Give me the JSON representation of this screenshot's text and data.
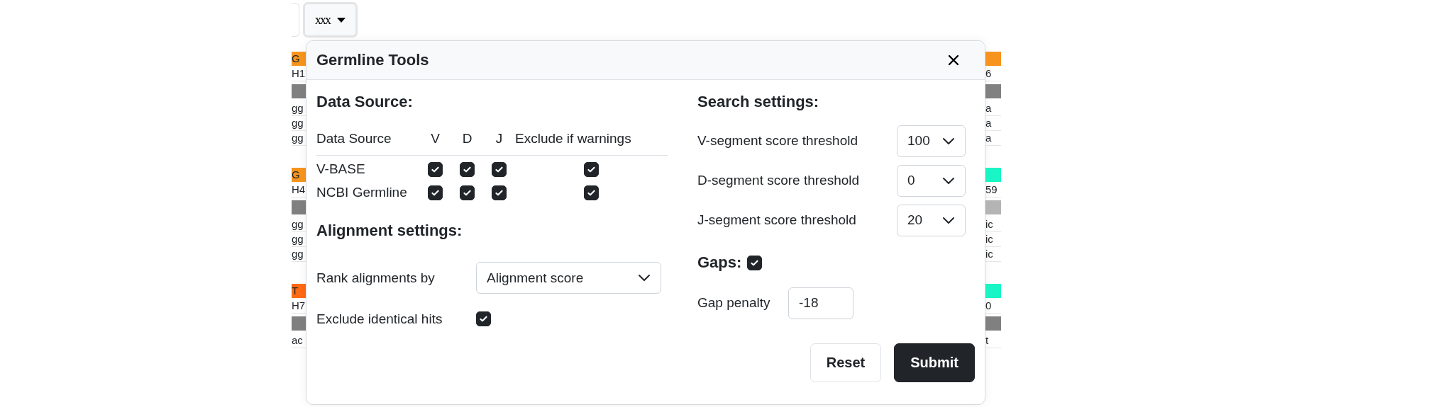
{
  "toolbar": {
    "dropdown": {
      "label": "xxx"
    }
  },
  "background_left": [
    {
      "kind": "tag",
      "text": "G",
      "color": "#f7941d"
    },
    {
      "kind": "text",
      "text": "H1"
    },
    {
      "kind": "bar",
      "color": "#808080"
    },
    {
      "kind": "text",
      "text": "gg"
    },
    {
      "kind": "text",
      "text": "gg"
    },
    {
      "kind": "text",
      "text": "gg"
    },
    {
      "kind": "gap"
    },
    {
      "kind": "tag",
      "text": "G",
      "color": "#f7941d"
    },
    {
      "kind": "text",
      "text": "H4"
    },
    {
      "kind": "bar",
      "color": "#808080"
    },
    {
      "kind": "text",
      "text": "gg"
    },
    {
      "kind": "text",
      "text": "gg"
    },
    {
      "kind": "text",
      "text": "gg"
    },
    {
      "kind": "gap"
    },
    {
      "kind": "tag",
      "text": "T",
      "color": "#ff6a13"
    },
    {
      "kind": "text",
      "text": "H7"
    },
    {
      "kind": "bar",
      "color": "#808080"
    },
    {
      "kind": "text",
      "text": "ac"
    }
  ],
  "background_right": [
    {
      "kind": "tag",
      "color": "#f7941d"
    },
    {
      "kind": "text",
      "text": "6"
    },
    {
      "kind": "bar",
      "color": "#808080"
    },
    {
      "kind": "text",
      "text": "a"
    },
    {
      "kind": "text",
      "text": "a"
    },
    {
      "kind": "text",
      "text": "a"
    },
    {
      "kind": "gap"
    },
    {
      "kind": "tag",
      "color": "#19f5c4"
    },
    {
      "kind": "text",
      "text": "59"
    },
    {
      "kind": "bar",
      "color": "#b4b4b4"
    },
    {
      "kind": "text",
      "text": "ic"
    },
    {
      "kind": "text",
      "text": "ic"
    },
    {
      "kind": "text",
      "text": "ic"
    },
    {
      "kind": "gap"
    },
    {
      "kind": "tag",
      "color": "#19f5c4"
    },
    {
      "kind": "text",
      "text": "0"
    },
    {
      "kind": "bar",
      "color": "#808080"
    },
    {
      "kind": "text",
      "text": "t"
    }
  ],
  "dialog": {
    "title": "Germline Tools",
    "data_source": {
      "heading": "Data Source:",
      "columns": [
        "Data Source",
        "V",
        "D",
        "J",
        "Exclude if warnings"
      ],
      "rows": [
        {
          "name": "V-BASE",
          "v": true,
          "d": true,
          "j": true,
          "exclude": true
        },
        {
          "name": "NCBI Germline",
          "v": true,
          "d": true,
          "j": true,
          "exclude": true
        }
      ]
    },
    "alignment": {
      "heading": "Alignment settings:",
      "rank_label": "Rank alignments by",
      "rank_value": "Alignment score",
      "exclude_label": "Exclude identical hits",
      "exclude_checked": true
    },
    "search": {
      "heading": "Search settings:",
      "thresholds": [
        {
          "label": "V-segment score threshold",
          "value": "100"
        },
        {
          "label": "D-segment score threshold",
          "value": "0"
        },
        {
          "label": "J-segment score threshold",
          "value": "20"
        }
      ]
    },
    "gaps": {
      "heading": "Gaps:",
      "checked": true,
      "penalty_label": "Gap penalty",
      "penalty_value": "-18"
    },
    "buttons": [
      {
        "label": "Reset",
        "kind": "secondary"
      },
      {
        "label": "Submit",
        "kind": "primary"
      }
    ]
  }
}
